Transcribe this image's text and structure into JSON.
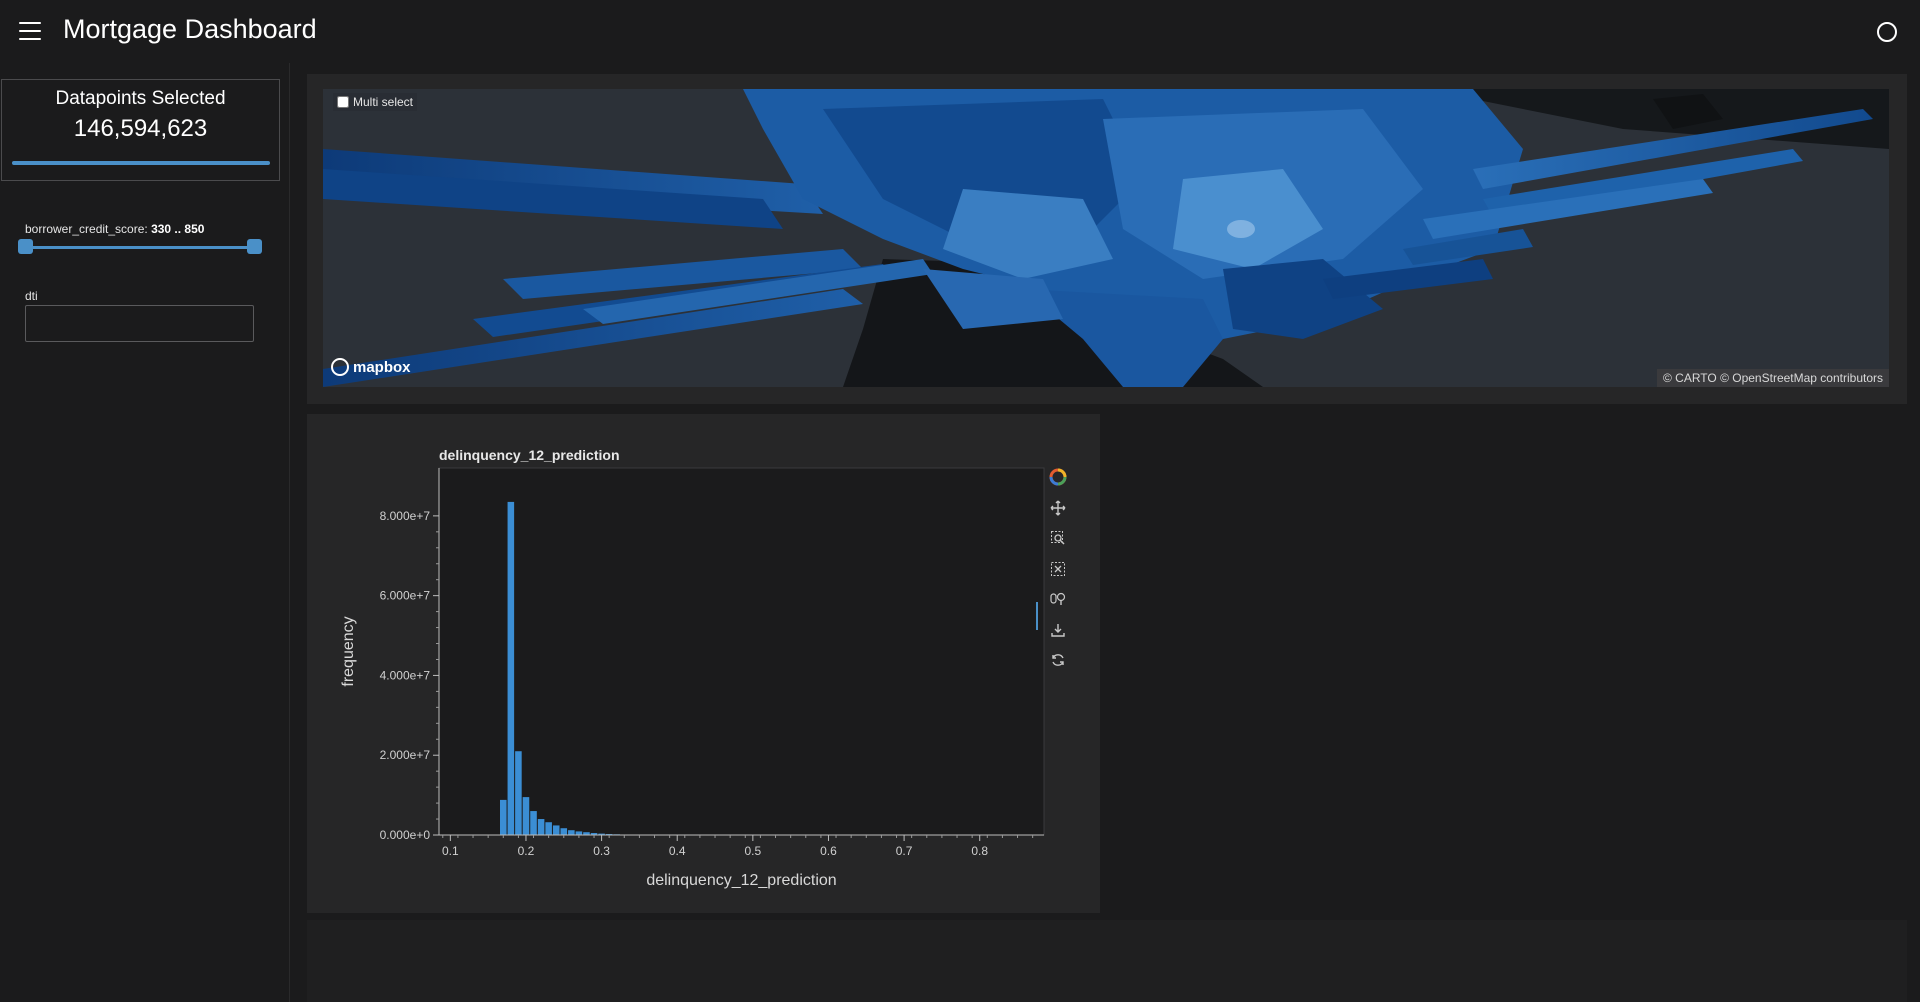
{
  "header": {
    "title": "Mortgage Dashboard"
  },
  "sidebar": {
    "count_card": {
      "title": "Datapoints Selected",
      "value": "146,594,623",
      "progress": 1.0
    },
    "credit_slider": {
      "label": "borrower_credit_score: ",
      "range_text": "330 .. 850",
      "min": 330,
      "max": 850,
      "low": 330,
      "high": 850
    },
    "dti": {
      "label": "dti",
      "value": ""
    }
  },
  "map": {
    "multi_select_label": "Multi select",
    "logo_text": "mapbox",
    "attribution": "© CARTO © OpenStreetMap contributors"
  },
  "chart_data": {
    "type": "bar",
    "title": "delinquency_12_prediction",
    "xlabel": "delinquency_12_prediction",
    "ylabel": "frequency",
    "xlim": [
      0.085,
      0.885
    ],
    "ylim": [
      0,
      92000000
    ],
    "xticks": [
      "0.1",
      "0.2",
      "0.3",
      "0.4",
      "0.5",
      "0.6",
      "0.7",
      "0.8"
    ],
    "yticks": [
      "0.000e+0",
      "2.000e+7",
      "4.000e+7",
      "6.000e+7",
      "8.000e+7"
    ],
    "bar_width": 0.01,
    "x": [
      0.17,
      0.18,
      0.19,
      0.2,
      0.21,
      0.22,
      0.23,
      0.24,
      0.25,
      0.26,
      0.27,
      0.28,
      0.29,
      0.3,
      0.31,
      0.32,
      0.33,
      0.34,
      0.35
    ],
    "values": [
      8800000,
      83500000,
      21000000,
      9500000,
      6000000,
      4000000,
      3200000,
      2400000,
      1700000,
      1200000,
      900000,
      700000,
      500000,
      350000,
      250000,
      180000,
      120000,
      80000,
      50000
    ],
    "bar_color": "#3b8ed4",
    "grid": false,
    "legend": "none"
  },
  "toolbar": {
    "tools": [
      {
        "name": "bokeh-logo-icon"
      },
      {
        "name": "pan-icon"
      },
      {
        "name": "box-zoom-icon"
      },
      {
        "name": "box-select-icon"
      },
      {
        "name": "wheel-zoom-icon"
      },
      {
        "name": "save-icon"
      },
      {
        "name": "reset-icon"
      }
    ]
  },
  "colors": {
    "accent": "#4a90c8",
    "background": "#1b1b1c",
    "panel": "#262627"
  }
}
